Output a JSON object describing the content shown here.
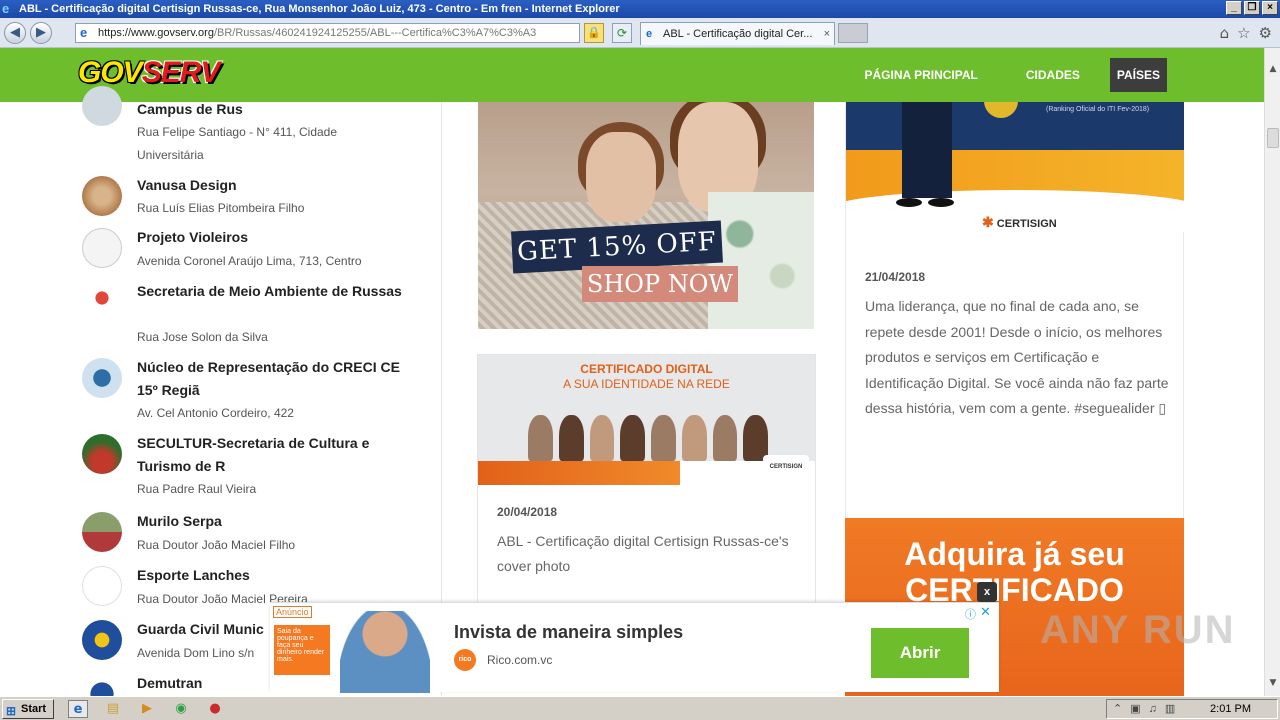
{
  "window": {
    "title": "ABL - Certificação digital Certisign Russas-ce, Rua Monsenhor João Luiz, 473 - Centro - Em fren - Internet Explorer"
  },
  "browser": {
    "url_main": "https://www.govserv.org",
    "url_rest": "/BR/Russas/460241924125255/ABL---Certifica%C3%A7%C3%A3",
    "tab_title": "ABL - Certificação digital Cer...",
    "tab_close": "×"
  },
  "site": {
    "logo_gov": "GOV",
    "logo_serv": "SERV",
    "nav": [
      "PÁGINA PRINCIPAL",
      "CIDADES",
      "PAÍSES"
    ]
  },
  "list": [
    {
      "name": "Campus de Rus",
      "addr": "Rua Felipe Santiago - N° 411, Cidade Universitária"
    },
    {
      "name": "Vanusa Design",
      "addr": "Rua Luís Elias Pitombeira Filho"
    },
    {
      "name": "Projeto Violeiros",
      "addr": "Avenida Coronel Araújo Lima, 713, Centro"
    },
    {
      "name": "Secretaria de Meio Ambiente de Russas",
      "addr": "Rua Jose Solon da Silva"
    },
    {
      "name": "Núcleo de Representação do CRECI CE 15º Regiã",
      "addr": "Av. Cel Antonio Cordeiro, 422"
    },
    {
      "name": "SECULTUR-Secretaria de Cultura e Turismo de R",
      "addr": "Rua Padre Raul Vieira"
    },
    {
      "name": "Murilo Serpa",
      "addr": "Rua Doutor João Maciel Filho"
    },
    {
      "name": "Esporte Lanches",
      "addr": "Rua Doutor João Maciel Pereira"
    },
    {
      "name": "Guarda Civil Munic",
      "addr": "Avenida Dom Lino s/n"
    },
    {
      "name": "Demutran",
      "addr": ""
    }
  ],
  "banner1": {
    "line1": "GET 15% OFF",
    "line2": "SHOP NOW"
  },
  "post1": {
    "banner_title": "CERTIFICADO DIGITAL",
    "banner_subtitle": "A SUA IDENTIDADE NA REDE",
    "banner_logo": "CERTISIGN",
    "date": "20/04/2018",
    "text": "ABL - Certificação digital Certisign Russas-ce's cover photo"
  },
  "post2": {
    "rank": "(Ranking Oficial do ITI Fev-2018)",
    "logo": "CERTISIGN",
    "date": "21/04/2018",
    "text": "Uma liderança, que no final de cada ano, se repete desde 2001! Desde o início, os melhores produtos e serviços em Certificação e Identificação Digital. Se você ainda não faz parte dessa história, vem com a gente. #seguealider ▯"
  },
  "banner4": {
    "line1": "Adquira já seu",
    "line2": "CERTIFICADO"
  },
  "ad": {
    "label": "Anúncio",
    "thumb_text": "Saia da poupança e faça seu dinheiro render mais.",
    "logo": "rico",
    "title": "Invista de maneira simples",
    "site": "Rico.com.vc",
    "button": "Abrir",
    "close_x": "x"
  },
  "watermark": "ANY RUN",
  "taskbar": {
    "start": "Start",
    "clock": "2:01 PM"
  }
}
